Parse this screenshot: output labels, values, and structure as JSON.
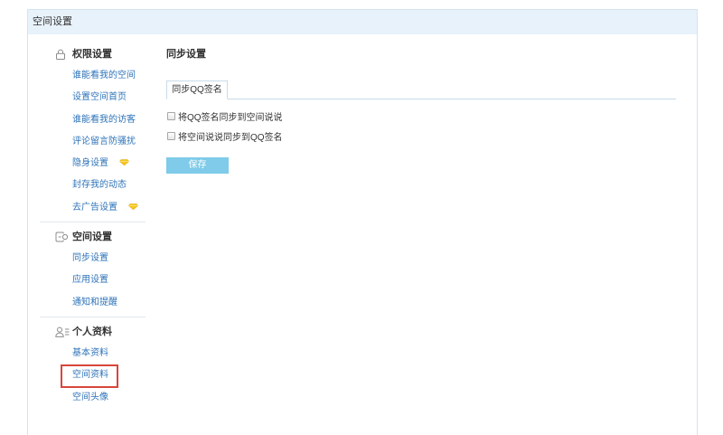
{
  "window": {
    "title": "空间设置"
  },
  "sidebar": {
    "sections": [
      {
        "title": "权限设置",
        "icon": "lock-icon",
        "items": [
          {
            "label": "谁能看我的空间"
          },
          {
            "label": "设置空间首页"
          },
          {
            "label": "谁能看我的访客"
          },
          {
            "label": "评论留言防骚扰"
          },
          {
            "label": "隐身设置",
            "badge": "vip-diamond-icon"
          },
          {
            "label": "封存我的动态"
          },
          {
            "label": "去广告设置",
            "badge": "vip-diamond-icon"
          }
        ]
      },
      {
        "title": "空间设置",
        "icon": "space-settings-icon",
        "items": [
          {
            "label": "同步设置"
          },
          {
            "label": "应用设置"
          },
          {
            "label": "通知和提醒"
          }
        ]
      },
      {
        "title": "个人资料",
        "icon": "profile-icon",
        "items": [
          {
            "label": "基本资料"
          },
          {
            "label": "空间资料",
            "highlighted": true
          },
          {
            "label": "空间头像"
          }
        ]
      }
    ]
  },
  "main": {
    "title": "同步设置",
    "tabs": [
      {
        "label": "同步QQ签名",
        "active": true
      }
    ],
    "options": [
      {
        "label": "将QQ签名同步到空间说说",
        "checked": false
      },
      {
        "label": "将空间说说同步到QQ签名",
        "checked": false
      }
    ],
    "save_label": "保存"
  },
  "colors": {
    "header_bg": "#e8f2fb",
    "link": "#2f74b9",
    "save_button": "#7fcbe9",
    "highlight_box": "#d8463b",
    "vip_badge": "#f6c71f"
  }
}
